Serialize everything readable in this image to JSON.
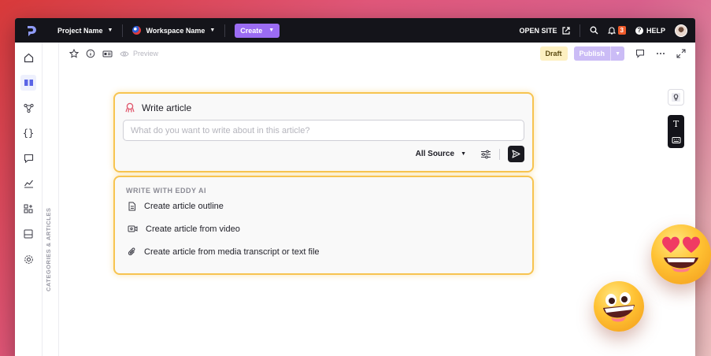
{
  "topbar": {
    "project": "Project Name",
    "workspace": "Workspace Name",
    "create": "Create",
    "open_site": "OPEN SITE",
    "notifications_count": "3",
    "help": "HELP"
  },
  "sidebar": {
    "items": [
      "home-icon",
      "book-icon",
      "workflow-icon",
      "code-braces-icon",
      "chat-icon",
      "analytics-icon",
      "apps-icon",
      "layout-icon",
      "settings-icon"
    ],
    "active_index": 1,
    "category_label": "CATEGORIES & ARTICLES"
  },
  "toolbar": {
    "preview": "Preview",
    "status": "Draft",
    "publish": "Publish"
  },
  "write_card": {
    "title": "Write article",
    "input_placeholder": "What do you want to write about in this article?",
    "source": "All Source"
  },
  "ai_card": {
    "heading": "WRITE WITH EDDY AI",
    "items": [
      {
        "label": "Create article outline",
        "icon": "document-icon"
      },
      {
        "label": "Create article from video",
        "icon": "video-icon"
      },
      {
        "label": "Create article from media transcript or text file",
        "icon": "paperclip-icon"
      }
    ]
  },
  "colors": {
    "accent": "#9b6cf3",
    "highlight_border": "#f7c450",
    "topbar_bg": "#14141a",
    "notification": "#ef5b2b"
  }
}
